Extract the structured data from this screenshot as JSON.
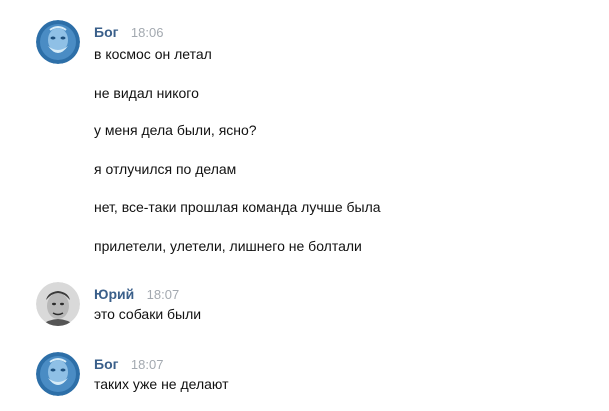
{
  "messages": [
    {
      "author": "Бог",
      "time": "18:06",
      "avatar_icon": "god-face-icon",
      "lines": [
        "в космос он летал",
        "не видал никого",
        "у меня дела были, ясно?",
        "я отлучился по делам",
        "нет, все-таки прошлая команда лучше была",
        "прилетели, улетели, лишнего не болтали"
      ]
    },
    {
      "author": "Юрий",
      "time": "18:07",
      "avatar_icon": "yuri-portrait-icon",
      "lines": [
        "это собаки были"
      ]
    },
    {
      "author": "Бог",
      "time": "18:07",
      "avatar_icon": "god-face-icon",
      "lines": [
        "таких уже не делают"
      ]
    }
  ],
  "colors": {
    "author": "#3a5f8a",
    "time": "#a3a9b0",
    "text": "#111111"
  }
}
